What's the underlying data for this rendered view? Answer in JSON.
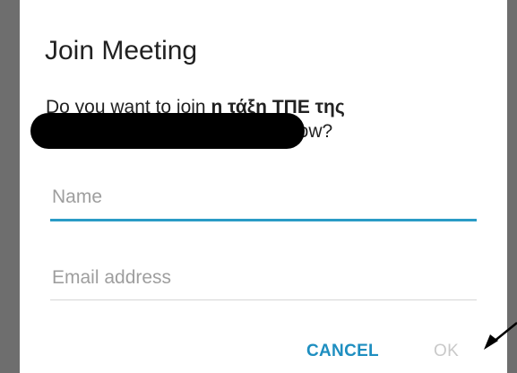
{
  "dialog": {
    "title": "Join Meeting",
    "message": {
      "prompt": "Do you want to join",
      "group_name": "η τάξη ΤΠΕ της",
      "suffix": "now?"
    },
    "fields": {
      "name_placeholder": "Name",
      "email_placeholder": "Email address"
    },
    "buttons": {
      "cancel_label": "CANCEL",
      "ok_label": "OK"
    }
  },
  "colors": {
    "accent": "#2a9bc6",
    "cancel_text": "#1e8ec0",
    "disabled_text": "#c9c9c9",
    "frame": "#6e6e6e",
    "redaction": "#000000",
    "annotation_arrow": "#000000"
  }
}
